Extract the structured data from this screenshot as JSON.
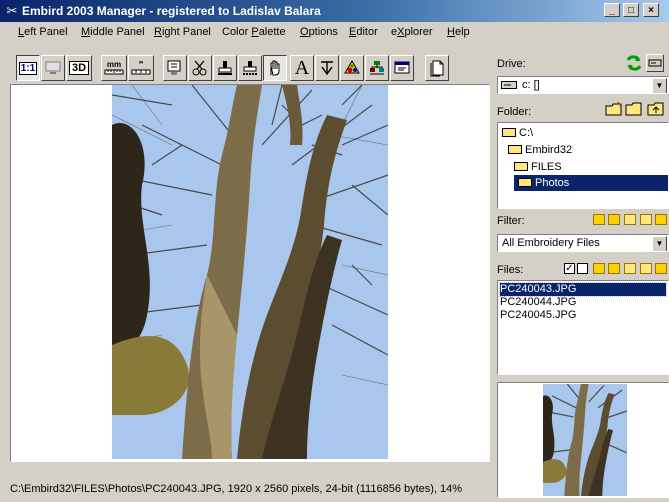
{
  "window": {
    "title": "Embird 2003 Manager - registered to Ladislav Balara",
    "app_icon": "embird-scissors-icon",
    "controls": [
      "minimize",
      "maximize",
      "close"
    ],
    "title_gradient": [
      "#0a246a",
      "#a6caf0"
    ]
  },
  "menu": [
    {
      "pre": "",
      "ul": "L",
      "post": "eft Panel"
    },
    {
      "pre": "",
      "ul": "M",
      "post": "iddle Panel"
    },
    {
      "pre": "",
      "ul": "R",
      "post": "ight Panel"
    },
    {
      "pre": "Color ",
      "ul": "P",
      "post": "alette"
    },
    {
      "pre": "",
      "ul": "O",
      "post": "ptions"
    },
    {
      "pre": "",
      "ul": "E",
      "post": "ditor"
    },
    {
      "pre": "e",
      "ul": "X",
      "post": "plorer"
    },
    {
      "pre": "",
      "ul": "H",
      "post": "elp"
    }
  ],
  "toolbar": {
    "view_1to1_label": "1:1",
    "view_3d_label": "3D",
    "units_mm_label": "mm",
    "units_in_label": "\"",
    "text_tool_label": "A",
    "icons": [
      "view-1to1-icon",
      "screen-icon",
      "view-3d-icon",
      "ruler-mm-icon",
      "ruler-inch-icon",
      "monitor-icon",
      "scissors-icon",
      "stamp-icon",
      "stamp2-icon",
      "hand-icon",
      "text-icon",
      "monogram-icon",
      "palette-icon",
      "tree-icon",
      "window-icon",
      "document-icon"
    ]
  },
  "preview": {
    "image": "photo of leafless tree trunks against blue sky",
    "colors": {
      "sky": "#aac8ee",
      "bark": "#6b5b3c",
      "shadow": "#2a2418"
    }
  },
  "status": {
    "text": "C:\\Embird32\\FILES\\Photos\\PC240043.JPG, 1920 x 2560 pixels, 24-bit (1116856 bytes), 14%"
  },
  "right_panel": {
    "drive_label": "Drive:",
    "drive_value": "c: []",
    "folder_label": "Folder:",
    "folders": [
      {
        "name": "C:\\",
        "indent": 0,
        "selected": false
      },
      {
        "name": "Embird32",
        "indent": 1,
        "selected": false
      },
      {
        "name": "FILES",
        "indent": 2,
        "selected": false
      },
      {
        "name": "Photos",
        "indent": 3,
        "selected": true
      }
    ],
    "filter_label": "Filter:",
    "filter_value": "All Embroidery Files",
    "files_label": "Files:",
    "files": [
      {
        "name": "PC240043.JPG",
        "selected": true
      },
      {
        "name": "PC240044.JPG",
        "selected": false
      },
      {
        "name": "PC240045.JPG",
        "selected": false
      }
    ],
    "selection_color": "#0a246a"
  }
}
